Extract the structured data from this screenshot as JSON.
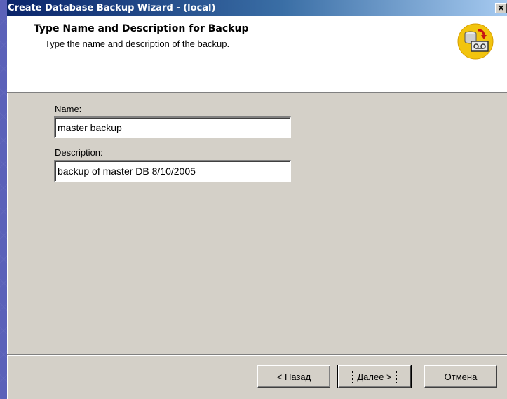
{
  "window": {
    "title": "Create Database Backup Wizard - (local)",
    "close_glyph": "×"
  },
  "header": {
    "title": "Type Name and Description for Backup",
    "subtitle": "Type the name and description of the backup.",
    "icon": "database-backup-icon"
  },
  "form": {
    "name_label": "Name:",
    "name_value": "master backup",
    "description_label": "Description:",
    "description_value": "backup of master DB 8/10/2005"
  },
  "buttons": {
    "back": "< Назад",
    "next": "Далее >",
    "cancel": "Отмена"
  },
  "colors": {
    "titlebar_start": "#0a246a",
    "titlebar_end": "#a6caf0",
    "dialog_face": "#d4d0c8",
    "desktop": "#5b61b9"
  }
}
